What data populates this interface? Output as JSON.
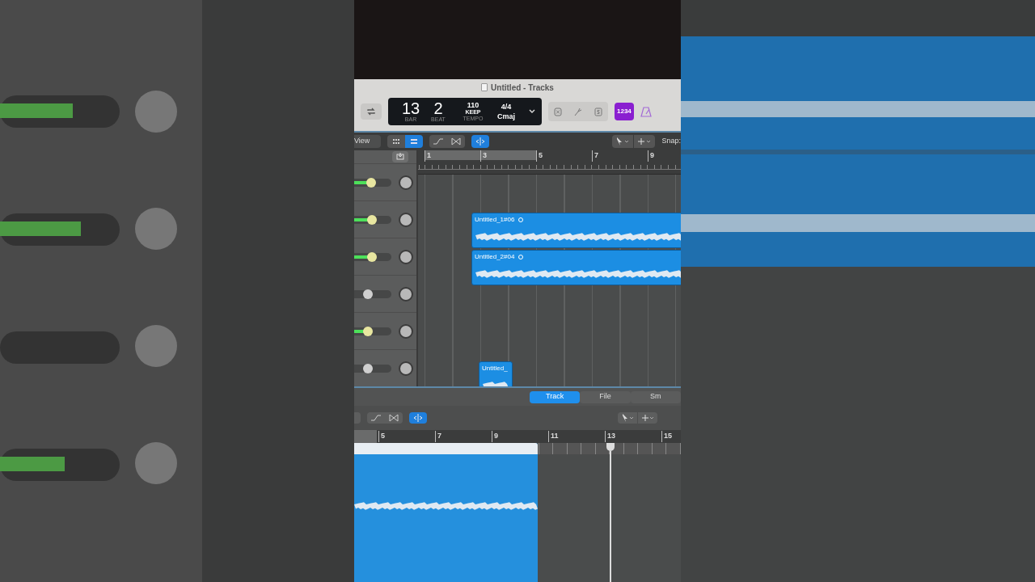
{
  "window": {
    "title": "Untitled - Tracks"
  },
  "lcd": {
    "bar": "13",
    "bar_label": "BAR",
    "beat": "2",
    "beat_label": "BEAT",
    "tempo": "110",
    "tempo_mode": "KEEP",
    "tempo_label": "TEMPO",
    "signature": "4/4",
    "key": "Cmaj"
  },
  "count_in": {
    "label": "1234",
    "selected": true
  },
  "toolbar": {
    "view": "View",
    "snap": "Snap:"
  },
  "ruler": [
    "1",
    "3",
    "5",
    "7",
    "9"
  ],
  "tracks": [
    {
      "level": 0.45,
      "active": true
    },
    {
      "level": 0.47,
      "active": true
    },
    {
      "level": 0.47,
      "active": true
    },
    {
      "level": 0.37,
      "active": false
    },
    {
      "level": 0.37,
      "active": true
    },
    {
      "level": 0.37,
      "active": false
    }
  ],
  "regions": [
    {
      "name": "Untitled_1#06"
    },
    {
      "name": "Untitled_2#04"
    },
    {
      "name": "Untitled_"
    }
  ],
  "editor_tabs": [
    {
      "label": "Track",
      "selected": true
    },
    {
      "label": "File",
      "selected": false
    },
    {
      "label": "Sm",
      "selected": false
    }
  ],
  "editor_ruler": [
    "5",
    "7",
    "9",
    "11",
    "13",
    "15"
  ]
}
